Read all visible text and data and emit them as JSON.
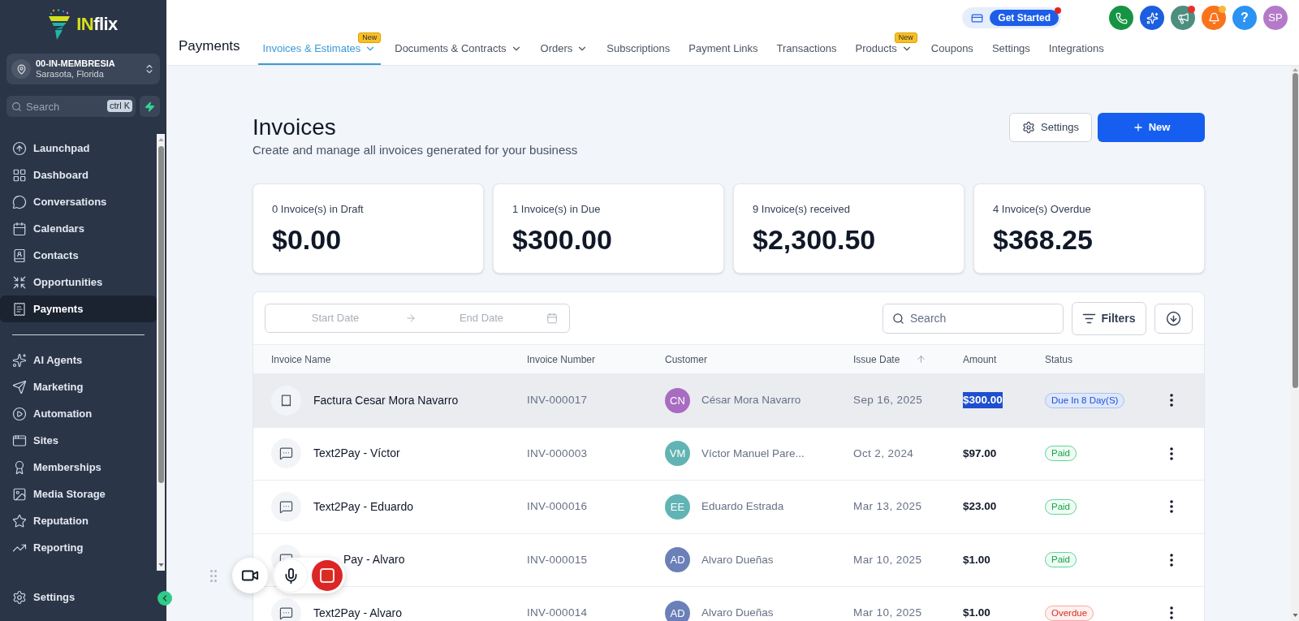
{
  "sidebar": {
    "logo": {
      "accent": "IN",
      "rest": "flix"
    },
    "account": {
      "name": "00-IN-MEMBRESIA",
      "location": "Sarasota, Florida"
    },
    "search": {
      "placeholder": "Search",
      "shortcut": "ctrl K"
    },
    "nav_items": [
      {
        "label": "Launchpad",
        "selected": false
      },
      {
        "label": "Dashboard",
        "selected": false
      },
      {
        "label": "Conversations",
        "selected": false
      },
      {
        "label": "Calendars",
        "selected": false
      },
      {
        "label": "Contacts",
        "selected": false
      },
      {
        "label": "Opportunities",
        "selected": false
      },
      {
        "label": "Payments",
        "selected": true
      }
    ],
    "nav_items_secondary": [
      {
        "label": "AI Agents",
        "selected": false
      },
      {
        "label": "Marketing",
        "selected": false
      },
      {
        "label": "Automation",
        "selected": false
      },
      {
        "label": "Sites",
        "selected": false
      },
      {
        "label": "Memberships",
        "selected": false
      },
      {
        "label": "Media Storage",
        "selected": false
      },
      {
        "label": "Reputation",
        "selected": false
      },
      {
        "label": "Reporting",
        "selected": false
      }
    ],
    "footer_item": {
      "label": "Settings",
      "selected": false
    }
  },
  "header": {
    "title": "Payments",
    "tabs": [
      {
        "label": "Invoices & Estimates",
        "selected": true,
        "dropdown": true,
        "badge": "New"
      },
      {
        "label": "Documents & Contracts",
        "selected": false,
        "dropdown": true
      },
      {
        "label": "Orders",
        "selected": false,
        "dropdown": true
      },
      {
        "label": "Subscriptions",
        "selected": false,
        "dropdown": false
      },
      {
        "label": "Payment Links",
        "selected": false,
        "dropdown": false
      },
      {
        "label": "Transactions",
        "selected": false,
        "dropdown": false
      },
      {
        "label": "Products",
        "selected": false,
        "dropdown": true,
        "badge": "New"
      },
      {
        "label": "Coupons",
        "selected": false,
        "dropdown": false
      },
      {
        "label": "Settings",
        "selected": false,
        "dropdown": false
      },
      {
        "label": "Integrations",
        "selected": false,
        "dropdown": false
      }
    ],
    "get_started": {
      "label": "Get Started",
      "unread": true
    },
    "action_icons": [
      {
        "unread": false
      },
      {
        "unread": false
      },
      {
        "unread": true
      },
      {
        "unread": true
      }
    ],
    "help": {
      "label": "?"
    },
    "user": {
      "initials": "SP"
    }
  },
  "page": {
    "title": "Invoices",
    "subtitle": "Create and manage all invoices generated for your business",
    "settings_button": "Settings",
    "new_button": "New"
  },
  "stats": [
    {
      "label": "0 Invoice(s) in Draft",
      "value": "$0.00"
    },
    {
      "label": "1 Invoice(s) in Due",
      "value": "$300.00"
    },
    {
      "label": "9 Invoice(s) received",
      "value": "$2,300.50"
    },
    {
      "label": "4 Invoice(s) Overdue",
      "value": "$368.25"
    }
  ],
  "table": {
    "date_range": {
      "start_placeholder": "Start Date",
      "end_placeholder": "End Date"
    },
    "search": {
      "placeholder": "Search"
    },
    "filters_button": "Filters",
    "columns": [
      {
        "label": "Invoice Name",
        "sorted": false
      },
      {
        "label": "Invoice Number",
        "sorted": false
      },
      {
        "label": "Customer",
        "sorted": false
      },
      {
        "label": "Issue Date",
        "sorted": true
      },
      {
        "label": "Amount",
        "sorted": false
      },
      {
        "label": "Status",
        "sorted": false
      }
    ],
    "rows": [
      {
        "kind": "receipt",
        "name": "Factura Cesar Mora Navarro",
        "name_covered": false,
        "number": "INV-000017",
        "customer": {
          "initials": "CN",
          "name": "César Mora Navarro",
          "color": "#a86cc1"
        },
        "date": "Sep 16, 2025",
        "amount": "$300.00",
        "amount_selected": true,
        "status": {
          "label": "Due In 8 Day(S)",
          "kind": "due"
        },
        "highlighted": true
      },
      {
        "kind": "text2pay",
        "name": "Text2Pay - Víctor",
        "name_covered": false,
        "number": "INV-000003",
        "customer": {
          "initials": "VM",
          "name": "Víctor Manuel Pare...",
          "color": "#62b4b4"
        },
        "date": "Oct 2, 2024",
        "amount": "$97.00",
        "amount_selected": false,
        "status": {
          "label": "Paid",
          "kind": "paid"
        },
        "highlighted": false
      },
      {
        "kind": "text2pay",
        "name": "Text2Pay - Eduardo",
        "name_covered": false,
        "number": "INV-000016",
        "customer": {
          "initials": "EE",
          "name": "Eduardo Estrada",
          "color": "#62b4b4"
        },
        "date": "Mar 13, 2025",
        "amount": "$23.00",
        "amount_selected": false,
        "status": {
          "label": "Paid",
          "kind": "paid"
        },
        "highlighted": false
      },
      {
        "kind": "text2pay",
        "name": "Pay - Alvaro",
        "name_covered": true,
        "number": "INV-000015",
        "customer": {
          "initials": "AD",
          "name": "Alvaro Dueñas",
          "color": "#6b80b8"
        },
        "date": "Mar 10, 2025",
        "amount": "$1.00",
        "amount_selected": false,
        "status": {
          "label": "Paid",
          "kind": "paid"
        },
        "highlighted": false
      },
      {
        "kind": "text2pay",
        "name": "Text2Pay - Alvaro",
        "name_covered": false,
        "number": "INV-000014",
        "customer": {
          "initials": "AD",
          "name": "Alvaro Dueñas",
          "color": "#6b80b8"
        },
        "date": "Mar 10, 2025",
        "amount": "$1.00",
        "amount_selected": false,
        "status": {
          "label": "Overdue",
          "kind": "overdue"
        },
        "highlighted": false
      }
    ]
  }
}
